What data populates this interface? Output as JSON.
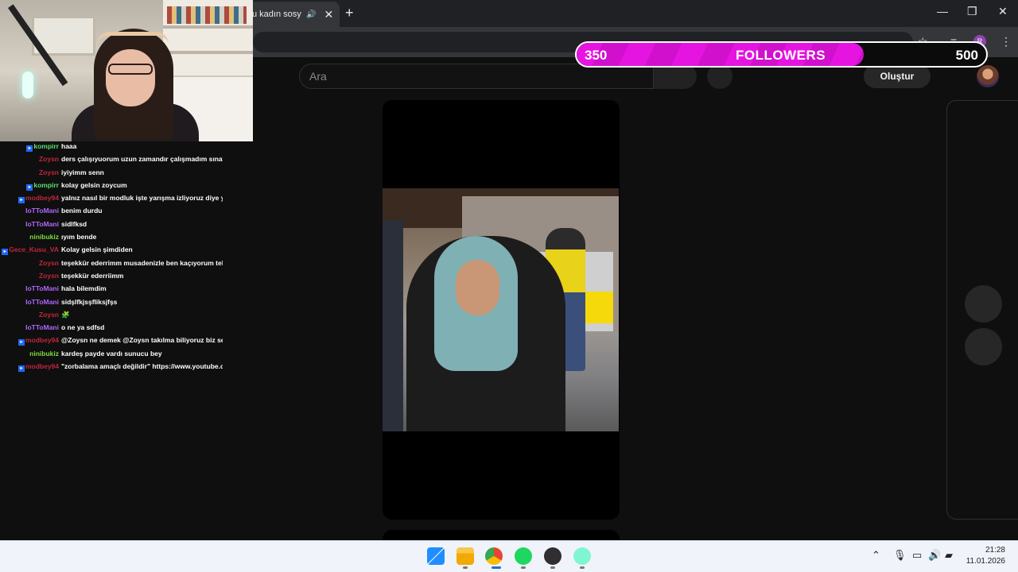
{
  "browser": {
    "tab_title": "u kadın sosyal",
    "new_tab_icon": "+",
    "close_tab_icon": "✕",
    "window_controls": {
      "minimize": "—",
      "maximize": "❐",
      "close": "✕"
    }
  },
  "header": {
    "search_placeholder": "Ara",
    "create_label": "Oluştur"
  },
  "followers_overlay": {
    "current": "350",
    "label": "FOLLOWERS",
    "goal": "500",
    "progress": 0.7,
    "fill_color": "#e614e0"
  },
  "chat": {
    "messages": [
      {
        "user": "kompirr",
        "color": "#5cdf6a",
        "badge": true,
        "text": "haaa"
      },
      {
        "user": "Zoysn",
        "color": "#c0263c",
        "badge": false,
        "text": "ders çalışıyuorum uzun zamandır çalışmadım sınav"
      },
      {
        "user": "Zoysn",
        "color": "#c0263c",
        "badge": false,
        "text": "iyiyimm senn"
      },
      {
        "user": "kompirr",
        "color": "#5cdf6a",
        "badge": true,
        "text": "kolay gelsin zoycum"
      },
      {
        "user": "modbey94",
        "color": "#c0263c",
        "badge": true,
        "text": "yalnız nasıl bir modluk işte yarışma izliyoruz diye ya"
      },
      {
        "user": "IoTToMani",
        "color": "#b266ff",
        "badge": false,
        "text": "benim durdu"
      },
      {
        "user": "IoTToMani",
        "color": "#b266ff",
        "badge": false,
        "text": "sidlfksd"
      },
      {
        "user": "ninibukiz",
        "color": "#7ddc3c",
        "badge": false,
        "text": "ıyım bende"
      },
      {
        "user": "Gece_Kusu_VA",
        "color": "#c0263c",
        "badge": true,
        "text": "Kolay gelsin şimdiden"
      },
      {
        "user": "Zoysn",
        "color": "#c0263c",
        "badge": false,
        "text": "teşekkür ederrimm musadenizle ben kaçıyorum tel"
      },
      {
        "user": "Zoysn",
        "color": "#c0263c",
        "badge": false,
        "text": "teşekkür ederriimm"
      },
      {
        "user": "IoTToMani",
        "color": "#b266ff",
        "badge": false,
        "text": "hala bilemdim"
      },
      {
        "user": "IoTToMani",
        "color": "#b266ff",
        "badge": false,
        "text": "sidşlfkjsşfliksjfşs"
      },
      {
        "user": "Zoysn",
        "color": "#c0263c",
        "badge": false,
        "text": "🧩"
      },
      {
        "user": "IoTToMani",
        "color": "#b266ff",
        "badge": false,
        "text": "o ne ya sdfsd"
      },
      {
        "user": "modbey94",
        "color": "#c0263c",
        "badge": true,
        "text": "@Zoysn ne demek @Zoysn takılma biliyoruz biz sen"
      },
      {
        "user": "ninibukiz",
        "color": "#7ddc3c",
        "badge": false,
        "text": "kardeş payde vardı sunucu bey"
      },
      {
        "user": "modbey94",
        "color": "#c0263c",
        "badge": true,
        "text": "\"zorbalama amaçlı değildir\" https://www.youtube.co"
      }
    ]
  },
  "taskbar": {
    "apps": [
      "windows-start-icon",
      "file-explorer-icon",
      "chrome-icon",
      "spotify-icon",
      "obs-icon",
      "streamlabs-icon"
    ],
    "time": "21:28",
    "date": "11.01.2026"
  }
}
